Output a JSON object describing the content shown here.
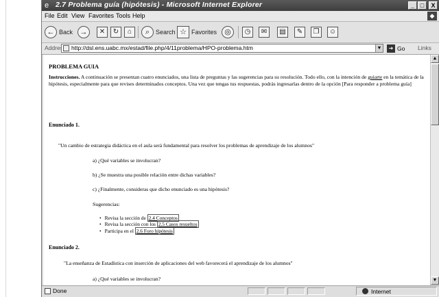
{
  "window": {
    "title": "2.7 Problema guía (hipótesis) - Microsoft Internet Explorer",
    "controls": {
      "minimize": "_",
      "maximize": "□",
      "close": "X"
    }
  },
  "menubar": {
    "items": [
      "File",
      "Edit",
      "View",
      "Favorites",
      "Tools",
      "Help"
    ]
  },
  "toolbar": {
    "back_label": "Back",
    "search_label": "Search",
    "favorites_label": "Favorites"
  },
  "address": {
    "label": "Address",
    "url": "http://dsl.ens.uabc.mx/estad/file.php/4/11problema/HPO-problema.htm",
    "go_label": "Go",
    "links_label": "Links"
  },
  "page": {
    "heading": "PROBLEMA GUIA",
    "intro_bold": "Instrucciones.",
    "intro_line1": " A continuación se presentan cuatro enunciados, una lista de preguntas y las sugerencias para su resolución. Todo ello, con la intención de ",
    "intro_guiarte": "guiarte",
    "intro_line2": " en la temática de la hipótesis, especialmente para que revises determinados conceptos. Una vez que tengas tus respuestas, podrás ingresarlas dentro de la opción [Para responder a problema guía]",
    "enunciado1": {
      "title": "Enunciado 1.",
      "quote": "\"Un cambio de estrategia didáctica en el aula será fundamental para resolver los problemas de aprendizaje de los alumnos\"",
      "q_a": "a) ¿Qué variables se involucran?",
      "q_b": "b) ¿Se muestra una posible relación entre dichas variables?",
      "q_c": "c) ¿Finalmente, consideras que dicho enunciado es una hipótesis?",
      "sugerencias_label": "Sugerencias:",
      "items": [
        {
          "prefix": "Revisa la sección de ",
          "link": "2.4 Conceptos"
        },
        {
          "prefix": "Revisa la sección con los ",
          "link": "2.5 Casos resueltos"
        },
        {
          "prefix": "Participa en el ",
          "link": "2.6 Foro hipótesis"
        }
      ]
    },
    "enunciado2": {
      "title": "Enunciado 2.",
      "quote": "\"La enseñanza de Estadística con inserción de aplicaciones del web favorecerá el aprendizaje de los alumnos\"",
      "q_a": "a) ¿Qué variables se involucran?"
    }
  },
  "status": {
    "left": "Done",
    "zone": "Internet"
  }
}
